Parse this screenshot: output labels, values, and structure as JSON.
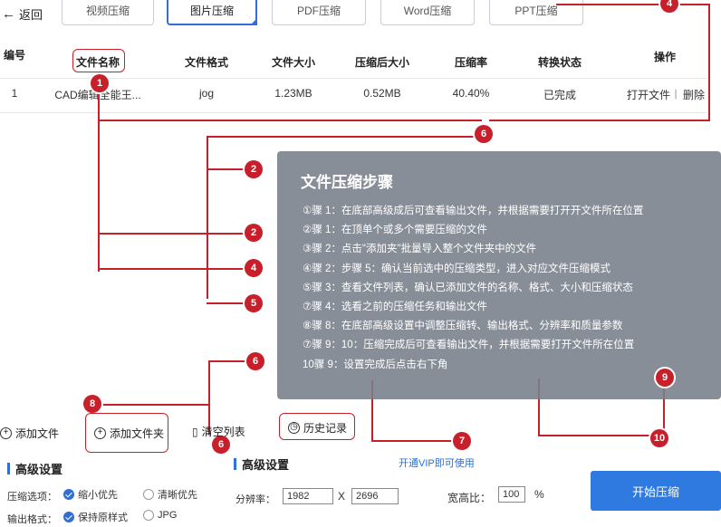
{
  "header": {
    "back_label": "返回",
    "tabs": [
      "视频压缩",
      "图片压缩",
      "PDF压缩",
      "Word压缩",
      "PPT压缩"
    ]
  },
  "table": {
    "columns": [
      "编号",
      "文件名称",
      "文件格式",
      "文件大小",
      "压缩后大小",
      "压缩率",
      "转换状态",
      "操作"
    ],
    "rows": [
      {
        "index": "1",
        "name": "CAD编辑全能王...",
        "format": "jog",
        "size": "1.23MB",
        "compressed_size": "0.52MB",
        "rate": "40.40%",
        "status": "已完成",
        "open_action": "打开文件",
        "separator": "|",
        "delete_action": "删除"
      }
    ]
  },
  "panel": {
    "title": "文件压缩步骤",
    "steps": [
      "①骤 1：在底部高级成后可查看输出文件，并根据需要打开开文件所在位置",
      "②骤 1：在顶单个或多个需要压缩的文件",
      "③骤 2：点击\"添加夹\"批量导入整个文件夹中的文件",
      "④骤 2：步骤 5：确认当前选中的压缩类型，进入对应文件压缩模式",
      "⑤骤 3：查看文件列表，确认已添加文件的名称、格式、大小和压缩状态",
      "⑦骤 4：选看之前的压缩任务和输出文件",
      "⑧骤 8：在底部高级设置中调整压缩转、输出格式、分辨率和质量参数",
      "⑦骤 9：10：压缩完成后可查看输出文件，并根据需要打开文件所在位置",
      "10骤 9：设置完成后点击右下角"
    ]
  },
  "annotations": [
    "1",
    "2",
    "2",
    "4",
    "5",
    "6",
    "6",
    "4",
    "6",
    "7",
    "8",
    "9",
    "10"
  ],
  "toolbar": {
    "add_file": "添加文件",
    "add_folder": "添加文件夹",
    "clear_list": "清空列表",
    "history": "历史记录",
    "vip_link": "开通VIP即可使用"
  },
  "settings": {
    "title_left": "高级设置",
    "title_right": "高级设置",
    "compress_label": "压缩选项：",
    "compress_opt1": "缩小优先",
    "compress_opt2": "清晰优先",
    "output_label": "输出格式：",
    "output_opt1": "保持原样式",
    "output_opt2": "JPG",
    "resolution_label": "分辨率：",
    "res_w": "1982",
    "res_x": "X",
    "res_h": "2696",
    "ratio_label": "宽高比：",
    "ratio_value": "100",
    "ratio_unit": "%",
    "start_button": "开始压缩"
  },
  "colors": {
    "accent": "#2f6fd6",
    "annotation": "#c8202a",
    "panel_bg": "#787e8a"
  }
}
